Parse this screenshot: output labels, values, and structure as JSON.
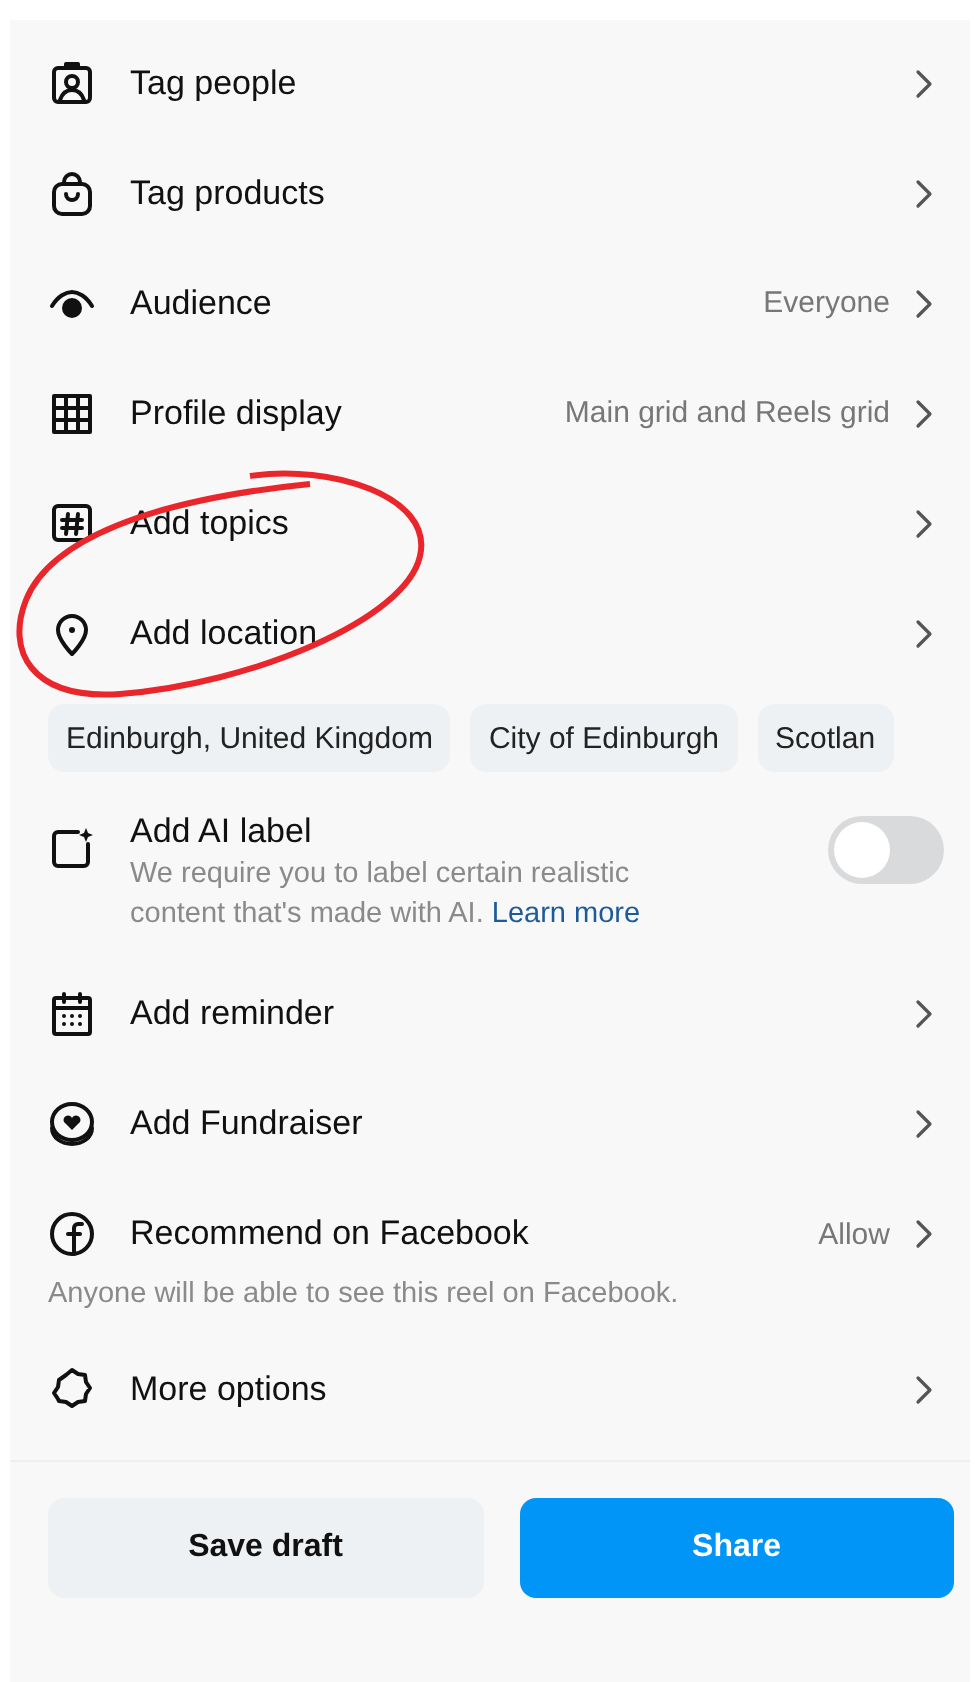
{
  "options": [
    {
      "kind": "link",
      "label": "Tag people"
    },
    {
      "kind": "link",
      "label": "Tag products"
    },
    {
      "kind": "link",
      "label": "Audience",
      "value": "Everyone"
    },
    {
      "kind": "link",
      "label": "Profile display",
      "value": "Main grid and Reels grid"
    },
    {
      "kind": "link",
      "label": "Add topics"
    },
    {
      "kind": "link",
      "label": "Add location"
    },
    {
      "kind": "chips",
      "chips": [
        "Edinburgh, United Kingdom",
        "City of Edinburgh",
        "Scotlan"
      ]
    },
    {
      "kind": "toggle",
      "label": "Add AI label",
      "description": "We require you to label certain realistic content that's made with AI.",
      "link": "Learn more",
      "on": false
    },
    {
      "kind": "link",
      "label": "Add reminder"
    },
    {
      "kind": "link",
      "label": "Add Fundraiser"
    },
    {
      "kind": "link",
      "label": "Recommend on Facebook",
      "value": "Allow",
      "note": "Anyone will be able to see this reel on Facebook."
    },
    {
      "kind": "link",
      "label": "More options"
    }
  ],
  "buttons": [
    {
      "kind": "secondary",
      "label": "Save draft"
    },
    {
      "kind": "primary",
      "label": "Share"
    }
  ]
}
